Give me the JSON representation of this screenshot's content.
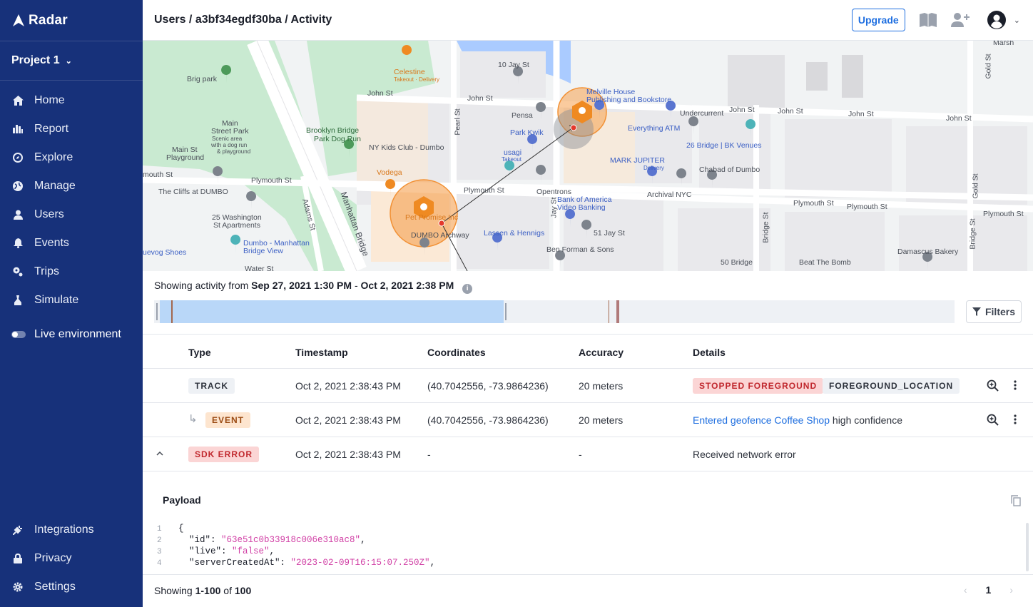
{
  "sidebar": {
    "brand": "Radar",
    "project": "Project 1",
    "items": [
      {
        "label": "Home",
        "icon": "home-icon"
      },
      {
        "label": "Report",
        "icon": "bar-chart-icon"
      },
      {
        "label": "Explore",
        "icon": "compass-icon"
      },
      {
        "label": "Manage",
        "icon": "globe-icon"
      },
      {
        "label": "Users",
        "icon": "user-icon"
      },
      {
        "label": "Events",
        "icon": "bell-icon"
      },
      {
        "label": "Trips",
        "icon": "trip-icon"
      },
      {
        "label": "Simulate",
        "icon": "simulate-icon"
      }
    ],
    "live_label": "Live environment",
    "bottom_items": [
      {
        "label": "Integrations",
        "icon": "plug-icon"
      },
      {
        "label": "Privacy",
        "icon": "lock-icon"
      },
      {
        "label": "Settings",
        "icon": "gear-icon"
      }
    ]
  },
  "header": {
    "breadcrumb": "Users / a3bf34egdf30ba / Activity",
    "upgrade_label": "Upgrade"
  },
  "map": {
    "labels": [
      "Marsh",
      "10 Jay St",
      "Celestine",
      "Takeout · Delivery",
      "Brig park",
      "John St",
      "Melville House",
      "Publishing and Bookstore",
      "Undercurrent",
      "Pensa",
      "Park Kwik",
      "Everything ATM",
      "usagi",
      "Takeout",
      "Main",
      "Street Park",
      "Scenic area",
      "with a dog run",
      "& playground",
      "Brooklyn Bridge",
      "Park Dog Run",
      "NY Kids Club - Dumbo",
      "Main St",
      "Playground",
      "Vodega",
      "MARK JUPITER",
      "Delivery",
      "26 Bridge | BK Venues",
      "Chabad of Dumbo",
      "Plymouth St",
      "Opentrons",
      "Archival NYC",
      "The Cliffs at DUMBO",
      "Bank of America",
      "Video Banking",
      "Pet Promise Inc",
      "25 Washington",
      "St Apartments",
      "DUMBO Archway",
      "Lassen & Hennigs",
      "51 Jay St",
      "Dumbo - Manhattan",
      "Bridge View",
      "Ben Forman & Sons",
      "Damascus Bakery",
      "uevog Shoes",
      "50 Bridge",
      "Beat The Bomb",
      "Adams St",
      "Manhattan Bridge",
      "Pearl St",
      "Jay St",
      "Gold St",
      "Bridge St",
      "mouth St",
      "Water St"
    ]
  },
  "activity": {
    "prefix": "Showing activity from",
    "start": "Sep 27, 2021 1:30 PM",
    "sep": "-",
    "end": "Oct 2, 2021 2:38 PM",
    "info": "i"
  },
  "filters_label": "Filters",
  "table": {
    "headers": {
      "type": "Type",
      "timestamp": "Timestamp",
      "coordinates": "Coordinates",
      "accuracy": "Accuracy",
      "details": "Details"
    },
    "rows": [
      {
        "type": "TRACK",
        "timestamp": "Oct 2, 2021 2:38:43 PM",
        "coordinates": "(40.7042556, -73.9864236)",
        "accuracy": "20 meters",
        "badge1": "STOPPED FOREGROUND",
        "badge2": "FOREGROUND_LOCATION"
      },
      {
        "type": "EVENT",
        "sub_arrow": "↳",
        "timestamp": "Oct 2, 2021 2:38:43 PM",
        "coordinates": "(40.7042556, -73.9864236)",
        "accuracy": "20 meters",
        "details_link": "Entered geofence Coffee Shop",
        "details_rest": " high confidence"
      },
      {
        "type": "SDK ERROR",
        "timestamp": "Oct 2, 2021 2:38:43 PM",
        "coordinates": "-",
        "accuracy": "-",
        "details": "Received network error"
      }
    ]
  },
  "payload": {
    "title": "Payload",
    "lines": [
      {
        "n": "1",
        "text": "{"
      },
      {
        "n": "2",
        "key": "  \"id\": ",
        "val": "\"63e51c0b33918c006e310ac8\"",
        "tail": ","
      },
      {
        "n": "3",
        "key": "  \"live\": ",
        "val": "\"false\"",
        "tail": ","
      },
      {
        "n": "4",
        "key": "  \"serverCreatedAt\": ",
        "val": "\"2023-02-09T16:15:07.250Z\"",
        "tail": ","
      }
    ]
  },
  "footer": {
    "prefix": "Showing ",
    "range": "1-100",
    "mid": " of ",
    "total": "100",
    "page": "1",
    "prev": "‹",
    "next": "›"
  },
  "colors": {
    "sidebar": "#17317a",
    "accent": "#1f6fe0",
    "geofence": "#f5a04e",
    "error": "#c0272d"
  }
}
